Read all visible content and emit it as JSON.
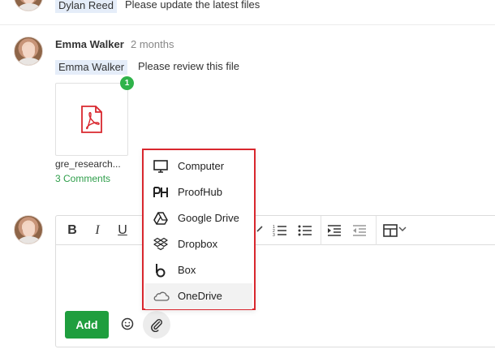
{
  "prev_comment": {
    "mention": "Dylan Reed",
    "text": "Please update the latest files"
  },
  "comment": {
    "author": "Emma Walker",
    "time": "2 months",
    "mention": "Emma Walker",
    "text": "Please review this file",
    "attachment": {
      "badge": "1",
      "file_name": "gre_research...",
      "comments_link": "3 Comments"
    }
  },
  "editor": {
    "toolbar_icons": [
      "bold-icon",
      "italic-icon",
      "underline-icon",
      "link-icon",
      "numbered-list-icon",
      "bulleted-list-icon",
      "indent-icon",
      "outdent-icon",
      "table-icon",
      "chevron-down-icon"
    ],
    "bold": "B",
    "italic": "I",
    "underline": "U",
    "add_label": "Add"
  },
  "attach_menu": {
    "items": [
      {
        "label": "Computer",
        "icon": "monitor-icon"
      },
      {
        "label": "ProofHub",
        "icon": "proofhub-icon"
      },
      {
        "label": "Google Drive",
        "icon": "google-drive-icon"
      },
      {
        "label": "Dropbox",
        "icon": "dropbox-icon"
      },
      {
        "label": "Box",
        "icon": "box-icon"
      },
      {
        "label": "OneDrive",
        "icon": "onedrive-icon"
      }
    ],
    "highlighted": "OneDrive",
    "border_color": "#d9272e"
  },
  "colors": {
    "accent_green": "#1f9e3e",
    "link_green": "#2e9e4a",
    "mention_bg": "#e5edf9",
    "pdf_red": "#d9272e"
  }
}
